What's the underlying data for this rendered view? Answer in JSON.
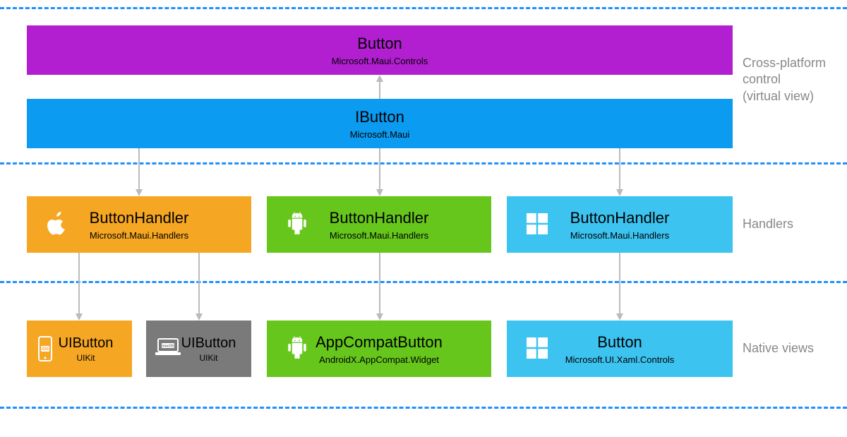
{
  "sections": {
    "top_label_line1": "Cross-platform",
    "top_label_line2": "control",
    "top_label_line3": "(virtual view)",
    "mid_label": "Handlers",
    "bottom_label": "Native views"
  },
  "boxes": {
    "button": {
      "title": "Button",
      "subtitle": "Microsoft.Maui.Controls"
    },
    "ibutton": {
      "title": "IButton",
      "subtitle": "Microsoft.Maui"
    },
    "handler_apple": {
      "title": "ButtonHandler",
      "subtitle": "Microsoft.Maui.Handlers"
    },
    "handler_android": {
      "title": "ButtonHandler",
      "subtitle": "Microsoft.Maui.Handlers"
    },
    "handler_windows": {
      "title": "ButtonHandler",
      "subtitle": "Microsoft.Maui.Handlers"
    },
    "native_ios": {
      "title": "UIButton",
      "subtitle": "UIKit"
    },
    "native_macos": {
      "title": "UIButton",
      "subtitle": "UIKit"
    },
    "native_android": {
      "title": "AppCompatButton",
      "subtitle": "AndroidX.AppCompat.Widget"
    },
    "native_windows": {
      "title": "Button",
      "subtitle": "Microsoft.UI.Xaml.Controls"
    }
  },
  "icons": {
    "ios_badge": "iOS",
    "macos_badge": "macOS"
  },
  "colors": {
    "purple": "#b21fd1",
    "blue": "#0b9bf0",
    "orange": "#f5a623",
    "green": "#66c61c",
    "skyblue": "#3cc3f0",
    "gray": "#7a7a7a"
  }
}
